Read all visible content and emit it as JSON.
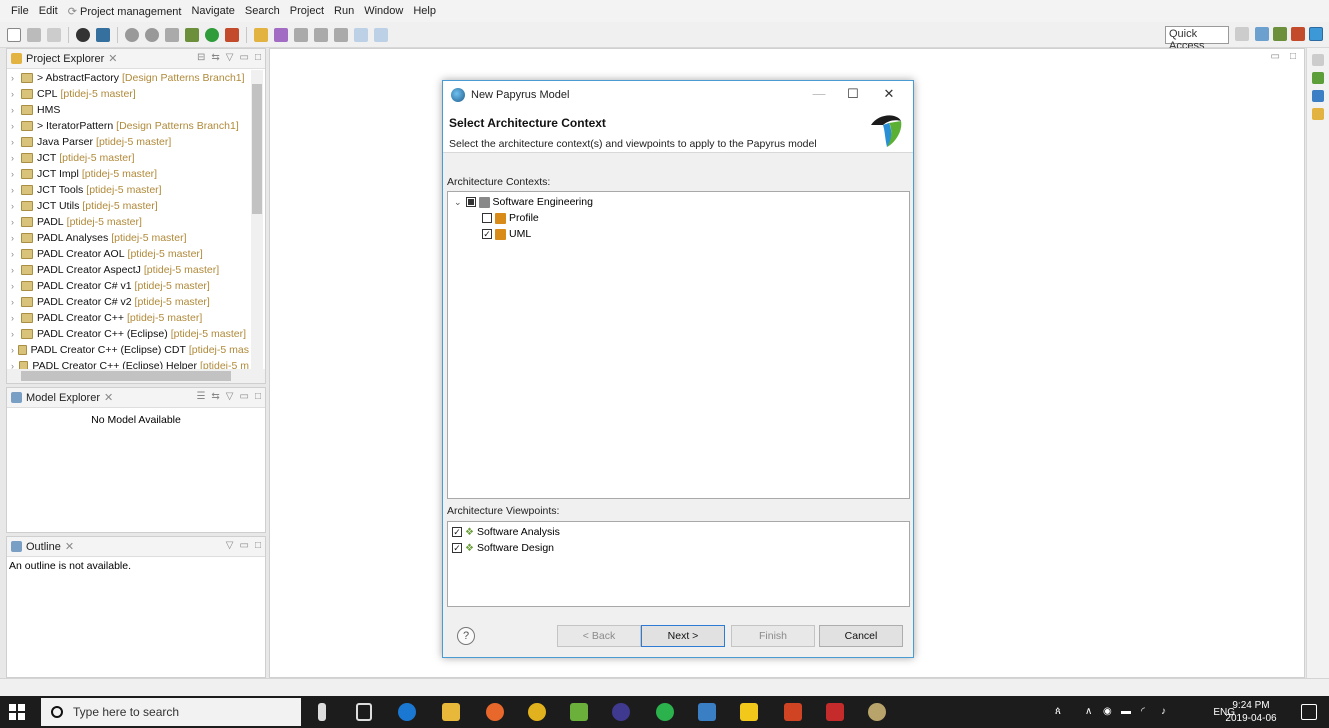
{
  "menubar": {
    "items": [
      "File",
      "Edit",
      "Project management",
      "Navigate",
      "Search",
      "Project",
      "Run",
      "Window",
      "Help"
    ]
  },
  "toolbar": {
    "quick_access": "Quick Access"
  },
  "project_explorer": {
    "title": "Project Explorer",
    "items": [
      {
        "prefix": "> ",
        "name": "AbstractFactory",
        "branch": "[Design Patterns Branch1]"
      },
      {
        "prefix": "",
        "name": "CPL",
        "branch": "[ptidej-5 master]"
      },
      {
        "prefix": "",
        "name": "HMS",
        "branch": ""
      },
      {
        "prefix": "> ",
        "name": "IteratorPattern",
        "branch": "[Design Patterns Branch1]"
      },
      {
        "prefix": "",
        "name": "Java Parser",
        "branch": "[ptidej-5 master]"
      },
      {
        "prefix": "",
        "name": "JCT",
        "branch": "[ptidej-5 master]"
      },
      {
        "prefix": "",
        "name": "JCT Impl",
        "branch": "[ptidej-5 master]"
      },
      {
        "prefix": "",
        "name": "JCT Tools",
        "branch": "[ptidej-5 master]"
      },
      {
        "prefix": "",
        "name": "JCT Utils",
        "branch": "[ptidej-5 master]"
      },
      {
        "prefix": "",
        "name": "PADL",
        "branch": "[ptidej-5 master]"
      },
      {
        "prefix": "",
        "name": "PADL Analyses",
        "branch": "[ptidej-5 master]"
      },
      {
        "prefix": "",
        "name": "PADL Creator AOL",
        "branch": "[ptidej-5 master]"
      },
      {
        "prefix": "",
        "name": "PADL Creator AspectJ",
        "branch": "[ptidej-5 master]"
      },
      {
        "prefix": "",
        "name": "PADL Creator C# v1",
        "branch": "[ptidej-5 master]"
      },
      {
        "prefix": "",
        "name": "PADL Creator C# v2",
        "branch": "[ptidej-5 master]"
      },
      {
        "prefix": "",
        "name": "PADL Creator C++",
        "branch": "[ptidej-5 master]"
      },
      {
        "prefix": "",
        "name": "PADL Creator C++ (Eclipse)",
        "branch": "[ptidej-5 master]"
      },
      {
        "prefix": "",
        "name": "PADL Creator C++ (Eclipse) CDT",
        "branch": "[ptidej-5 mas"
      },
      {
        "prefix": "",
        "name": "PADL Creator C++ (Eclipse) Helper",
        "branch": "[ptidej-5 m"
      }
    ]
  },
  "model_explorer": {
    "title": "Model Explorer",
    "empty_text": "No Model Available"
  },
  "outline": {
    "title": "Outline",
    "empty_text": "An outline is not available."
  },
  "dialog": {
    "window_title": "New Papyrus Model",
    "header_title": "Select Architecture Context",
    "header_description": "Select the architecture context(s) and viewpoints to apply to the Papyrus model",
    "contexts_label": "Architecture Contexts:",
    "contexts": {
      "root": "Software Engineering",
      "children": [
        {
          "label": "Profile",
          "checked": false
        },
        {
          "label": "UML",
          "checked": true
        }
      ]
    },
    "viewpoints_label": "Architecture Viewpoints:",
    "viewpoints": [
      {
        "label": "Software Analysis",
        "checked": true
      },
      {
        "label": "Software Design",
        "checked": true
      }
    ],
    "buttons": {
      "back": "< Back",
      "next": "Next >",
      "finish": "Finish",
      "cancel": "Cancel"
    }
  },
  "taskbar": {
    "search_placeholder": "Type here to search",
    "language": "ENG",
    "time": "9:24 PM",
    "date": "2019-04-06"
  },
  "colors": {
    "dialog_border": "#4a9ad4",
    "branch_text": "#b08a3a",
    "taskbar_bg": "#1c1c1c"
  }
}
